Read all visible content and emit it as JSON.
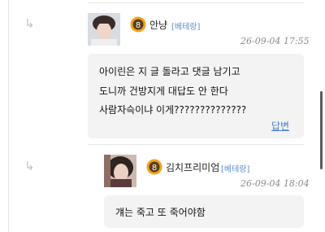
{
  "comments": [
    {
      "nickname": "안냥",
      "role": "[베테랑]",
      "level": "8",
      "date": "26-09-04 17:55",
      "lines": [
        "아이린은 지 글 돌라고 댓글 남기고",
        "도니까 건방지게 대답도 안 한다",
        "사람자슥이냐 이게??????????????"
      ],
      "reply_label": "답변"
    },
    {
      "nickname": "김치프리미엄",
      "role": "[베테랑]",
      "level": "8",
      "date": "26-09-04 18:04",
      "lines": [
        "걔는 죽고 또 죽어야함"
      ]
    }
  ],
  "colors": {
    "level_badge": "#f2a31b",
    "role_text": "#5b8fd3",
    "reply_link": "#4a7fd4",
    "bubble_bg": "#f3f3f3"
  },
  "icons": {
    "reply_indicator": "reply-arrow-icon",
    "level_badge": "level-badge-icon"
  }
}
